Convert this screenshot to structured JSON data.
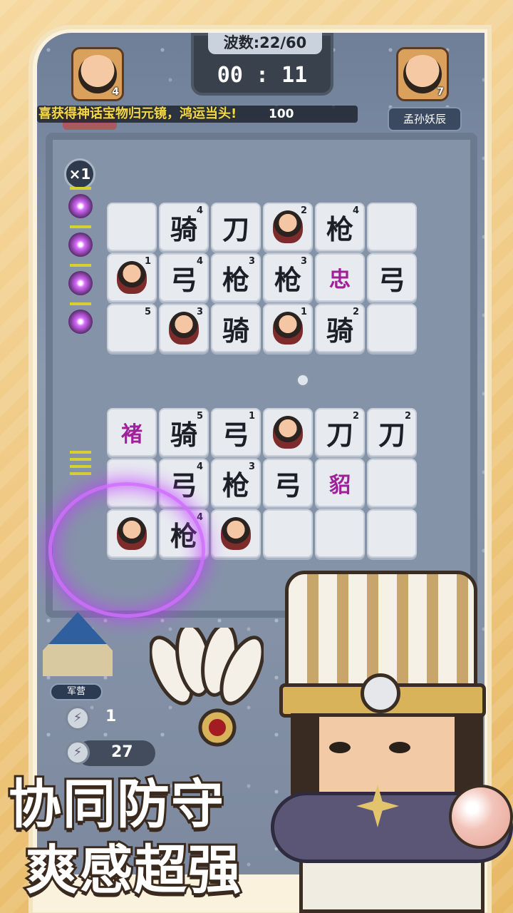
{
  "hud": {
    "wave_text": "波数:22/60",
    "timer": "00 : 11",
    "left_hero_level": "4",
    "right_hero_level": "7",
    "ticker": "喜获得神话宝物归元镜，鸿运当头!",
    "ticker_number": "100",
    "left_tag": "",
    "right_tag": "孟孙妖辰",
    "speed": "×1"
  },
  "board": {
    "upper_rows": [
      [
        {
          "g": "",
          "n": ""
        },
        {
          "g": "骑",
          "n": "4"
        },
        {
          "g": "刀",
          "n": ""
        },
        {
          "g": "unit",
          "n": "2"
        },
        {
          "g": "枪",
          "n": "4"
        },
        {
          "g": "",
          "n": ""
        }
      ],
      [
        {
          "g": "unit",
          "n": "1"
        },
        {
          "g": "弓",
          "n": "4"
        },
        {
          "g": "枪",
          "n": "3"
        },
        {
          "g": "枪",
          "n": "3"
        },
        {
          "g": "忠",
          "n": "",
          "purple": true
        },
        {
          "g": "弓",
          "n": ""
        }
      ],
      [
        {
          "g": "",
          "n": "5"
        },
        {
          "g": "unit",
          "n": "3"
        },
        {
          "g": "骑",
          "n": ""
        },
        {
          "g": "unit",
          "n": "1"
        },
        {
          "g": "骑",
          "n": "2"
        },
        {
          "g": "",
          "n": ""
        }
      ]
    ],
    "lower_rows": [
      [
        {
          "g": "褚",
          "n": "",
          "purple": true
        },
        {
          "g": "骑",
          "n": "5"
        },
        {
          "g": "弓",
          "n": "1"
        },
        {
          "g": "unit",
          "n": ""
        },
        {
          "g": "刀",
          "n": "2"
        },
        {
          "g": "刀",
          "n": "2"
        }
      ],
      [
        {
          "g": "",
          "n": ""
        },
        {
          "g": "弓",
          "n": "4"
        },
        {
          "g": "枪",
          "n": "3"
        },
        {
          "g": "弓",
          "n": ""
        },
        {
          "g": "貂",
          "n": "",
          "purple": true
        },
        {
          "g": "",
          "n": ""
        }
      ],
      [
        {
          "g": "unit",
          "n": ""
        },
        {
          "g": "枪",
          "n": "4"
        },
        {
          "g": "unit",
          "n": ""
        },
        {
          "g": "",
          "n": ""
        },
        {
          "g": "",
          "n": ""
        },
        {
          "g": "",
          "n": ""
        }
      ]
    ]
  },
  "bottom": {
    "camp_label": "军营",
    "bolt_count_1": "1",
    "bolt_count_2": "27"
  },
  "slogan": {
    "line1": "协同防守",
    "line2": "爽感超强"
  }
}
